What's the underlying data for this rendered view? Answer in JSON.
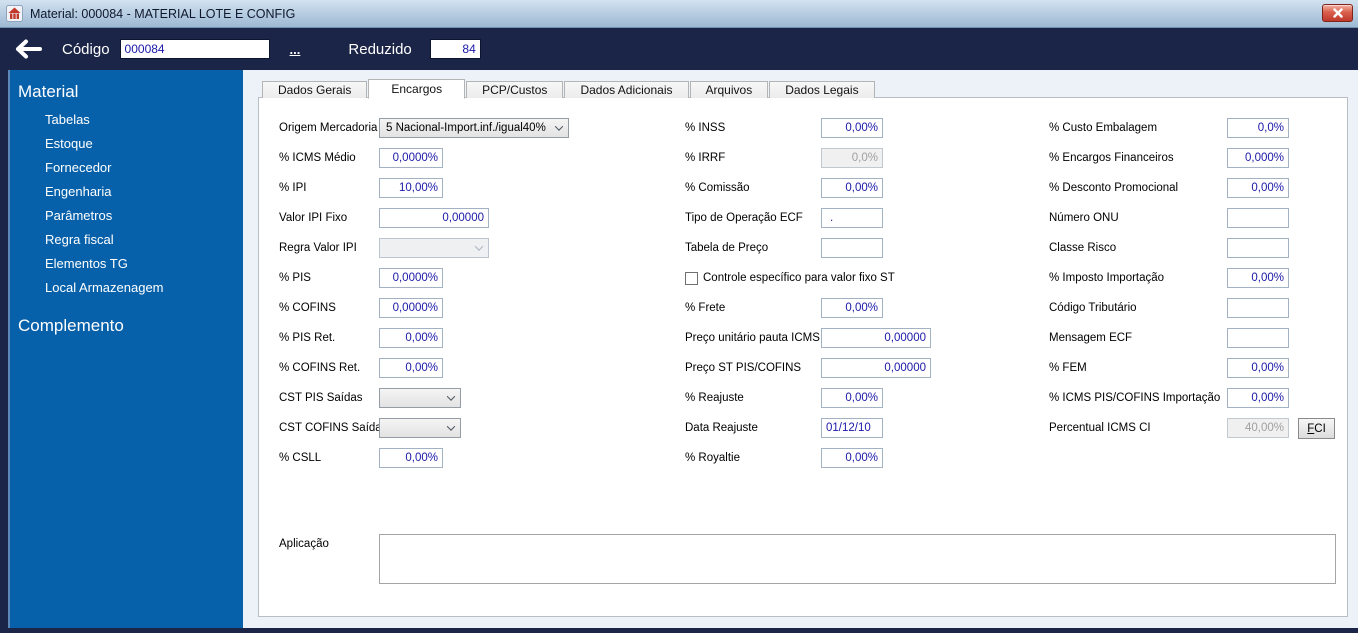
{
  "window": {
    "title": "Material: 000084 - MATERIAL LOTE E CONFIG"
  },
  "icons": {
    "app": "app-logo-icon",
    "close": "close-icon",
    "back": "back-arrow-icon",
    "combo": "chevron-down-icon"
  },
  "toolbar": {
    "codigo_label": "Código",
    "codigo_value": "000084",
    "browse_link": "...",
    "reduzido_label": "Reduzido",
    "reduzido_value": "84"
  },
  "sidebar": {
    "section1_title": "Material",
    "items": [
      "Tabelas",
      "Estoque",
      "Fornecedor",
      "Engenharia",
      "Parâmetros",
      "Regra fiscal",
      "Elementos TG",
      "Local Armazenagem"
    ],
    "section2_title": "Complemento"
  },
  "tabs": [
    {
      "label": "Dados Gerais",
      "active": false
    },
    {
      "label": "Encargos",
      "active": true
    },
    {
      "label": "PCP/Custos",
      "active": false
    },
    {
      "label": "Dados Adicionais",
      "active": false
    },
    {
      "label": "Arquivos",
      "active": false
    },
    {
      "label": "Dados Legais",
      "active": false
    }
  ],
  "form": {
    "col1": [
      {
        "label": "Origem Mercadoria",
        "value": "5 Nacional-Import.inf./igual40%",
        "type": "select"
      },
      {
        "label": "% ICMS Médio",
        "value": "0,0000%"
      },
      {
        "label": "% IPI",
        "value": "10,00%"
      },
      {
        "label": "Valor IPI Fixo",
        "value": "0,00000"
      },
      {
        "label": "Regra Valor IPI",
        "value": "",
        "type": "select",
        "disabled": true
      },
      {
        "label": "% PIS",
        "value": "0,0000%"
      },
      {
        "label": "% COFINS",
        "value": "0,0000%"
      },
      {
        "label": "% PIS Ret.",
        "value": "0,00%"
      },
      {
        "label": "% COFINS Ret.",
        "value": "0,00%"
      },
      {
        "label": "CST PIS Saídas",
        "value": "",
        "type": "select"
      },
      {
        "label": "CST COFINS Saídas",
        "value": "",
        "type": "select"
      },
      {
        "label": "% CSLL",
        "value": "0,00%"
      }
    ],
    "col2": [
      {
        "label": "% INSS",
        "value": "0,00%"
      },
      {
        "label": "% IRRF",
        "value": "0,0%",
        "disabled": true
      },
      {
        "label": "% Comissão",
        "value": "0,00%"
      },
      {
        "label": "Tipo de Operação ECF",
        "value": "."
      },
      {
        "label": "Tabela de Preço",
        "value": ""
      },
      {
        "label": "Controle específico para valor fixo ST",
        "type": "checkbox",
        "checked": false
      },
      {
        "label": "% Frete",
        "value": "0,00%"
      },
      {
        "label": "Preço unitário pauta ICMS",
        "value": "0,00000"
      },
      {
        "label": "Preço ST PIS/COFINS",
        "value": "0,00000"
      },
      {
        "label": "% Reajuste",
        "value": "0,00%"
      },
      {
        "label": "Data Reajuste",
        "value": "01/12/10"
      },
      {
        "label": "% Royaltie",
        "value": "0,00%"
      }
    ],
    "col3": [
      {
        "label": "% Custo Embalagem",
        "value": "0,0%"
      },
      {
        "label": "% Encargos Financeiros",
        "value": "0,000%"
      },
      {
        "label": "% Desconto Promocional",
        "value": "0,00%"
      },
      {
        "label": "Número ONU",
        "value": ""
      },
      {
        "label": "Classe Risco",
        "value": ""
      },
      {
        "label": "% Imposto Importação",
        "value": "0,00%"
      },
      {
        "label": "Código Tributário",
        "value": ""
      },
      {
        "label": "Mensagem ECF",
        "value": ""
      },
      {
        "label": "% FEM",
        "value": "0,00%"
      },
      {
        "label": "% ICMS PIS/COFINS Importação",
        "value": "0,00%"
      },
      {
        "label": "Percentual ICMS CI",
        "value": "40,00%",
        "disabled": true
      }
    ],
    "fci_button": "FCI",
    "aplicacao_label": "Aplicação",
    "aplicacao_value": ""
  },
  "colors": {
    "sidebar_blue": "#0761aa",
    "toolbar_navy": "#1b2547",
    "value_text": "#1a18a8",
    "close_red": "#c0392b"
  }
}
